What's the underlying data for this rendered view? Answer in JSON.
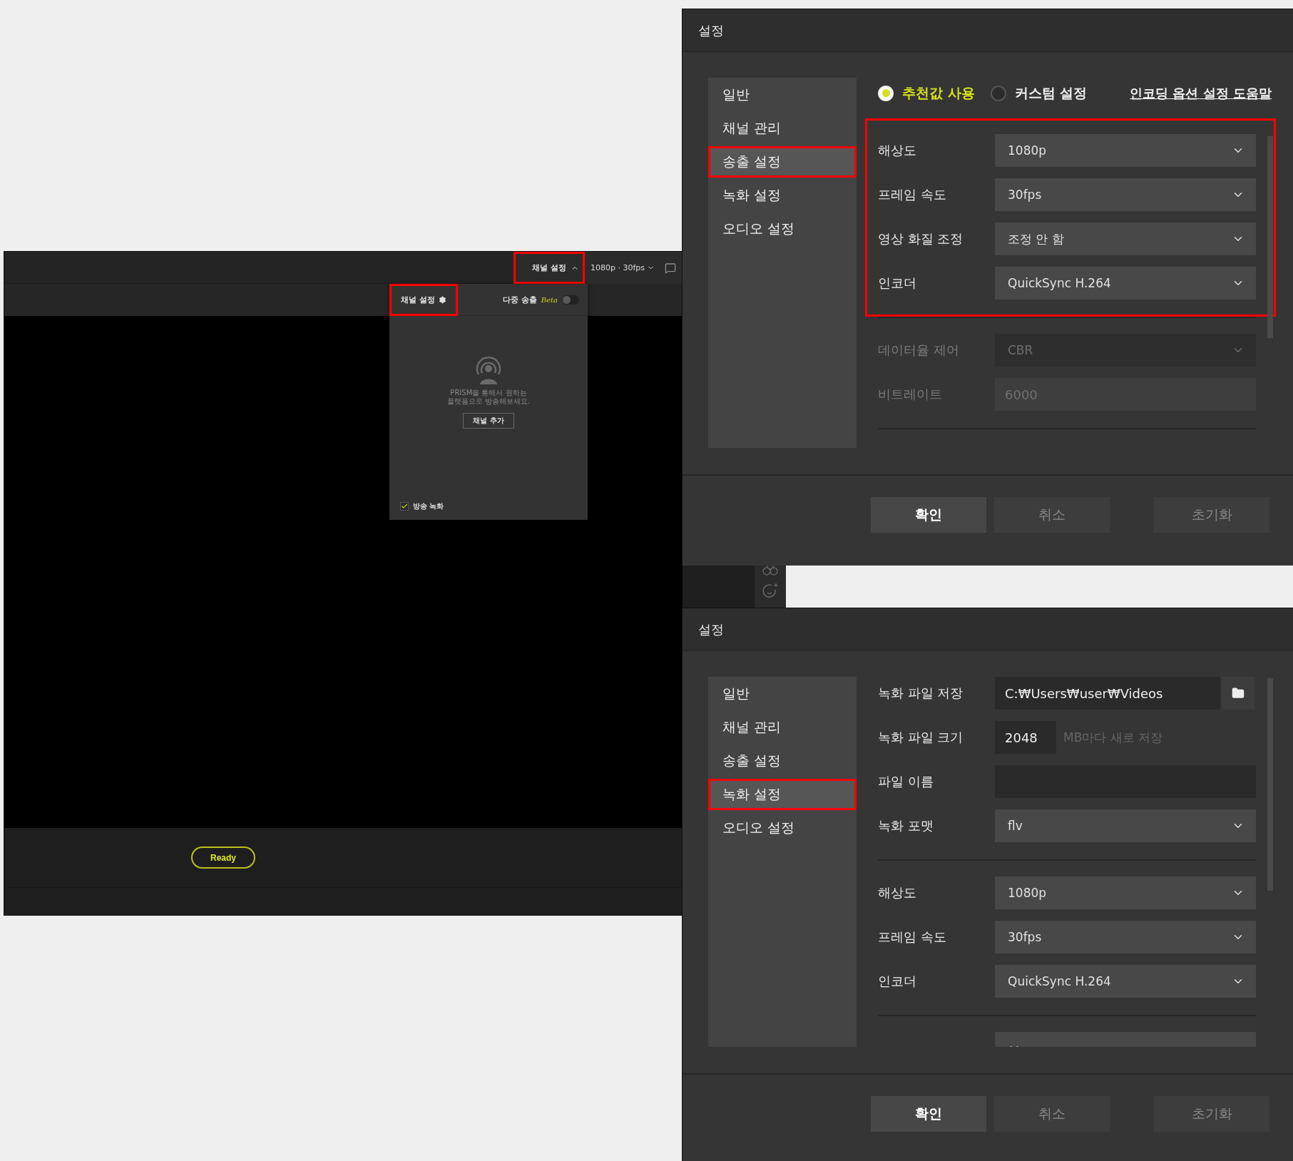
{
  "app_window": {
    "top_bar": {
      "channel_button": {
        "label": "채널 설정",
        "highlighted": true
      },
      "quality_button": "1080p · 30fps"
    },
    "channel_panel": {
      "title": "채널 설정",
      "highlighted": true,
      "multi_stream": {
        "label": "다중 송출",
        "badge": "Beta",
        "on": false
      },
      "message": "PRISM을 통해서 원하는\n플랫폼으로 방송해보세요.",
      "add_button": "채널 추가",
      "record": {
        "label": "방송 녹화",
        "checked": true
      }
    },
    "status": "Ready"
  },
  "dialogs": [
    {
      "title": "설정",
      "sidebar": [
        {
          "label": "일반",
          "selected": false,
          "highlighted": false
        },
        {
          "label": "채널 관리",
          "selected": false,
          "highlighted": false
        },
        {
          "label": "송출 설정",
          "selected": true,
          "highlighted": true
        },
        {
          "label": "녹화 설정",
          "selected": false,
          "highlighted": false
        },
        {
          "label": "오디오 설정",
          "selected": false,
          "highlighted": false
        }
      ],
      "mode_options": [
        {
          "label": "추천값 사용",
          "selected": true
        },
        {
          "label": "커스텀 설정",
          "selected": false
        }
      ],
      "help_link": "인코딩 옵션 설정 도움말",
      "groups": [
        {
          "highlighted": true,
          "rows": [
            {
              "kind": "dropdown",
              "label": "해상도",
              "value": "1080p",
              "disabled": false
            },
            {
              "kind": "dropdown",
              "label": "프레임 속도",
              "value": "30fps",
              "disabled": false
            },
            {
              "kind": "dropdown",
              "label": "영상 화질 조정",
              "value": "조정 안 함",
              "disabled": false
            },
            {
              "kind": "dropdown",
              "label": "인코더",
              "value": "QuickSync H.264",
              "disabled": false
            }
          ]
        },
        {
          "highlighted": false,
          "rows": [
            {
              "kind": "dropdown",
              "label": "데이터율 제어",
              "value": "CBR",
              "disabled": true
            },
            {
              "kind": "input",
              "label": "비트레이트",
              "value": "6000",
              "disabled": true
            }
          ]
        }
      ],
      "buttons": [
        {
          "label": "확인",
          "kind": "primary"
        },
        {
          "label": "취소",
          "kind": "secondary"
        },
        {
          "label": "초기화",
          "kind": "secondary"
        }
      ]
    },
    {
      "title": "설정",
      "sidebar": [
        {
          "label": "일반",
          "selected": false,
          "highlighted": false
        },
        {
          "label": "채널 관리",
          "selected": false,
          "highlighted": false
        },
        {
          "label": "송출 설정",
          "selected": false,
          "highlighted": false
        },
        {
          "label": "녹화 설정",
          "selected": true,
          "highlighted": true
        },
        {
          "label": "오디오 설정",
          "selected": false,
          "highlighted": false
        }
      ],
      "groups": [
        {
          "highlighted": false,
          "rows": [
            {
              "kind": "path",
              "label": "녹화 파일 저장",
              "value": "C:₩Users₩user₩Videos",
              "disabled": false
            },
            {
              "kind": "size",
              "label": "녹화 파일 크기",
              "value": "2048",
              "note": "MB마다 새로 저장",
              "disabled": false
            },
            {
              "kind": "text",
              "label": "파일 이름",
              "disabled": false
            },
            {
              "kind": "dropdown",
              "label": "녹화 포맷",
              "value": "flv",
              "disabled": false
            }
          ]
        },
        {
          "highlighted": false,
          "rows": [
            {
              "kind": "dropdown",
              "label": "해상도",
              "value": "1080p",
              "disabled": false
            },
            {
              "kind": "dropdown",
              "label": "프레임 속도",
              "value": "30fps",
              "disabled": false
            },
            {
              "kind": "dropdown",
              "label": "인코더",
              "value": "QuickSync H.264",
              "disabled": false
            }
          ]
        },
        {
          "highlighted": false,
          "rows": [
            {
              "kind": "dropdown",
              "disabled": false
            }
          ]
        }
      ],
      "buttons": [
        {
          "label": "확인",
          "kind": "primary"
        },
        {
          "label": "취소",
          "kind": "secondary"
        },
        {
          "label": "초기화",
          "kind": "secondary"
        }
      ]
    }
  ]
}
